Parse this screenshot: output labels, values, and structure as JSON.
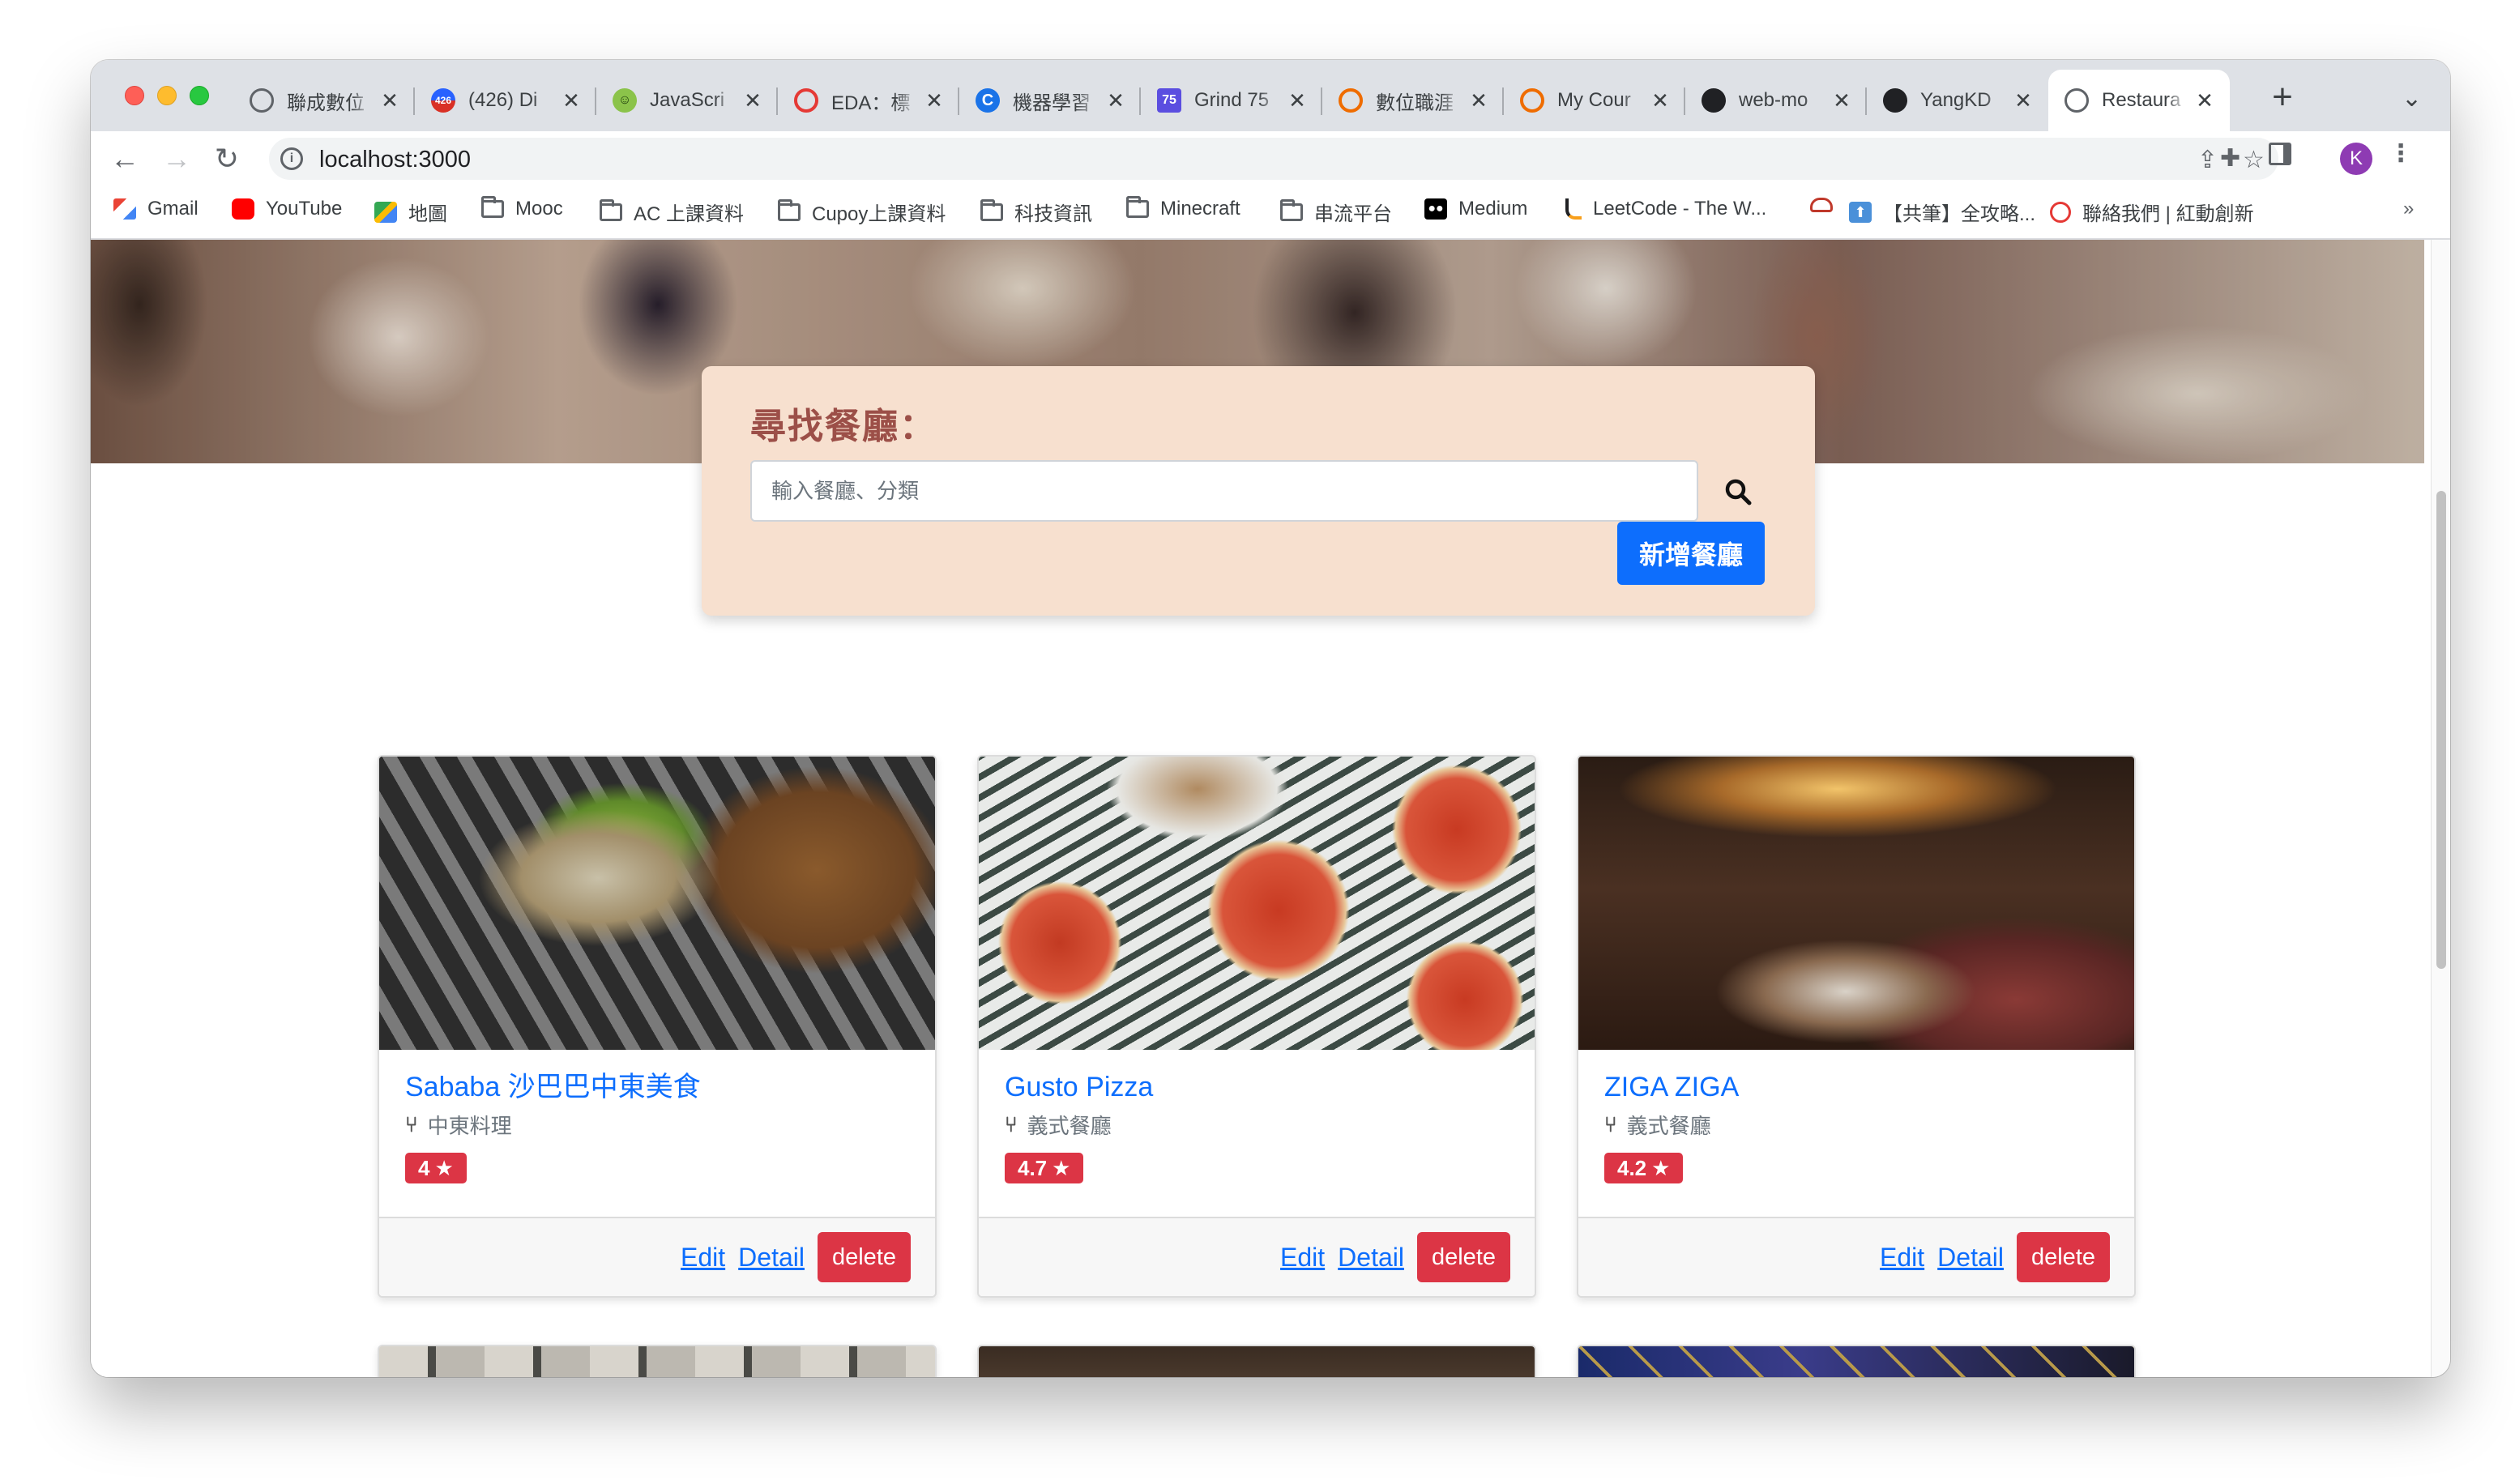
{
  "tabs": [
    {
      "title": "聯成數位",
      "icon": "globe-icon",
      "color": "#5f6368"
    },
    {
      "title": "(426) Di",
      "icon": "badge-426-icon",
      "color": "#d93025",
      "badge": "426"
    },
    {
      "title": "JavaScri",
      "icon": "javascript-icon",
      "color": "#8bc34a"
    },
    {
      "title": "EDA：標",
      "icon": "eda-icon",
      "color": "#e53935"
    },
    {
      "title": "機器學習",
      "icon": "c-logo-icon",
      "color": "#1a73e8"
    },
    {
      "title": "Grind 75",
      "icon": "grind75-icon",
      "color": "#5b4ee0",
      "badge": "75"
    },
    {
      "title": "數位職涯",
      "icon": "alphacamp-icon",
      "color": "#ef6c00"
    },
    {
      "title": "My Cour",
      "icon": "alphacamp-icon",
      "color": "#ef6c00"
    },
    {
      "title": "web-mo",
      "icon": "github-icon",
      "color": "#202124"
    },
    {
      "title": "YangKD",
      "icon": "github-icon",
      "color": "#202124"
    },
    {
      "title": "Restaura",
      "icon": "globe-icon",
      "color": "#5f6368",
      "active": true
    }
  ],
  "toolbar": {
    "url": "localhost:3000"
  },
  "bookmarks": [
    {
      "label": "Gmail",
      "icon": "gmail-icon"
    },
    {
      "label": "YouTube",
      "icon": "youtube-icon"
    },
    {
      "label": "地圖",
      "icon": "maps-icon"
    },
    {
      "label": "Mooc",
      "icon": "folder-icon"
    },
    {
      "label": "AC 上課資料",
      "icon": "folder-icon"
    },
    {
      "label": "Cupoy上課資料",
      "icon": "folder-icon"
    },
    {
      "label": "科技資訊",
      "icon": "folder-icon"
    },
    {
      "label": "Minecraft",
      "icon": "folder-icon"
    },
    {
      "label": "串流平台",
      "icon": "folder-icon"
    },
    {
      "label": "Medium",
      "icon": "medium-icon"
    },
    {
      "label": "LeetCode - The W...",
      "icon": "leetcode-icon"
    },
    {
      "label": "",
      "icon": "car-icon"
    },
    {
      "label": "【共筆】全攻略...",
      "icon": "upload-icon"
    },
    {
      "label": "聯絡我們 | 紅動創新",
      "icon": "redmotion-icon"
    }
  ],
  "search": {
    "title": "尋找餐廳：",
    "placeholder": "輸入餐廳、分類",
    "add_label": "新增餐廳"
  },
  "restaurants": [
    {
      "name": "Sababa 沙巴巴中東美食",
      "category": "中東料理",
      "rating": "4"
    },
    {
      "name": "Gusto Pizza",
      "category": "義式餐廳",
      "rating": "4.7"
    },
    {
      "name": "ZIGA ZIGA",
      "category": "義式餐廳",
      "rating": "4.2"
    }
  ],
  "card_actions": {
    "edit": "Edit",
    "detail": "Detail",
    "delete": "delete"
  },
  "colors": {
    "primary": "#0d6efd",
    "danger": "#dc3545",
    "search_bg": "#f7e0cf",
    "title": "#9c4f48"
  }
}
